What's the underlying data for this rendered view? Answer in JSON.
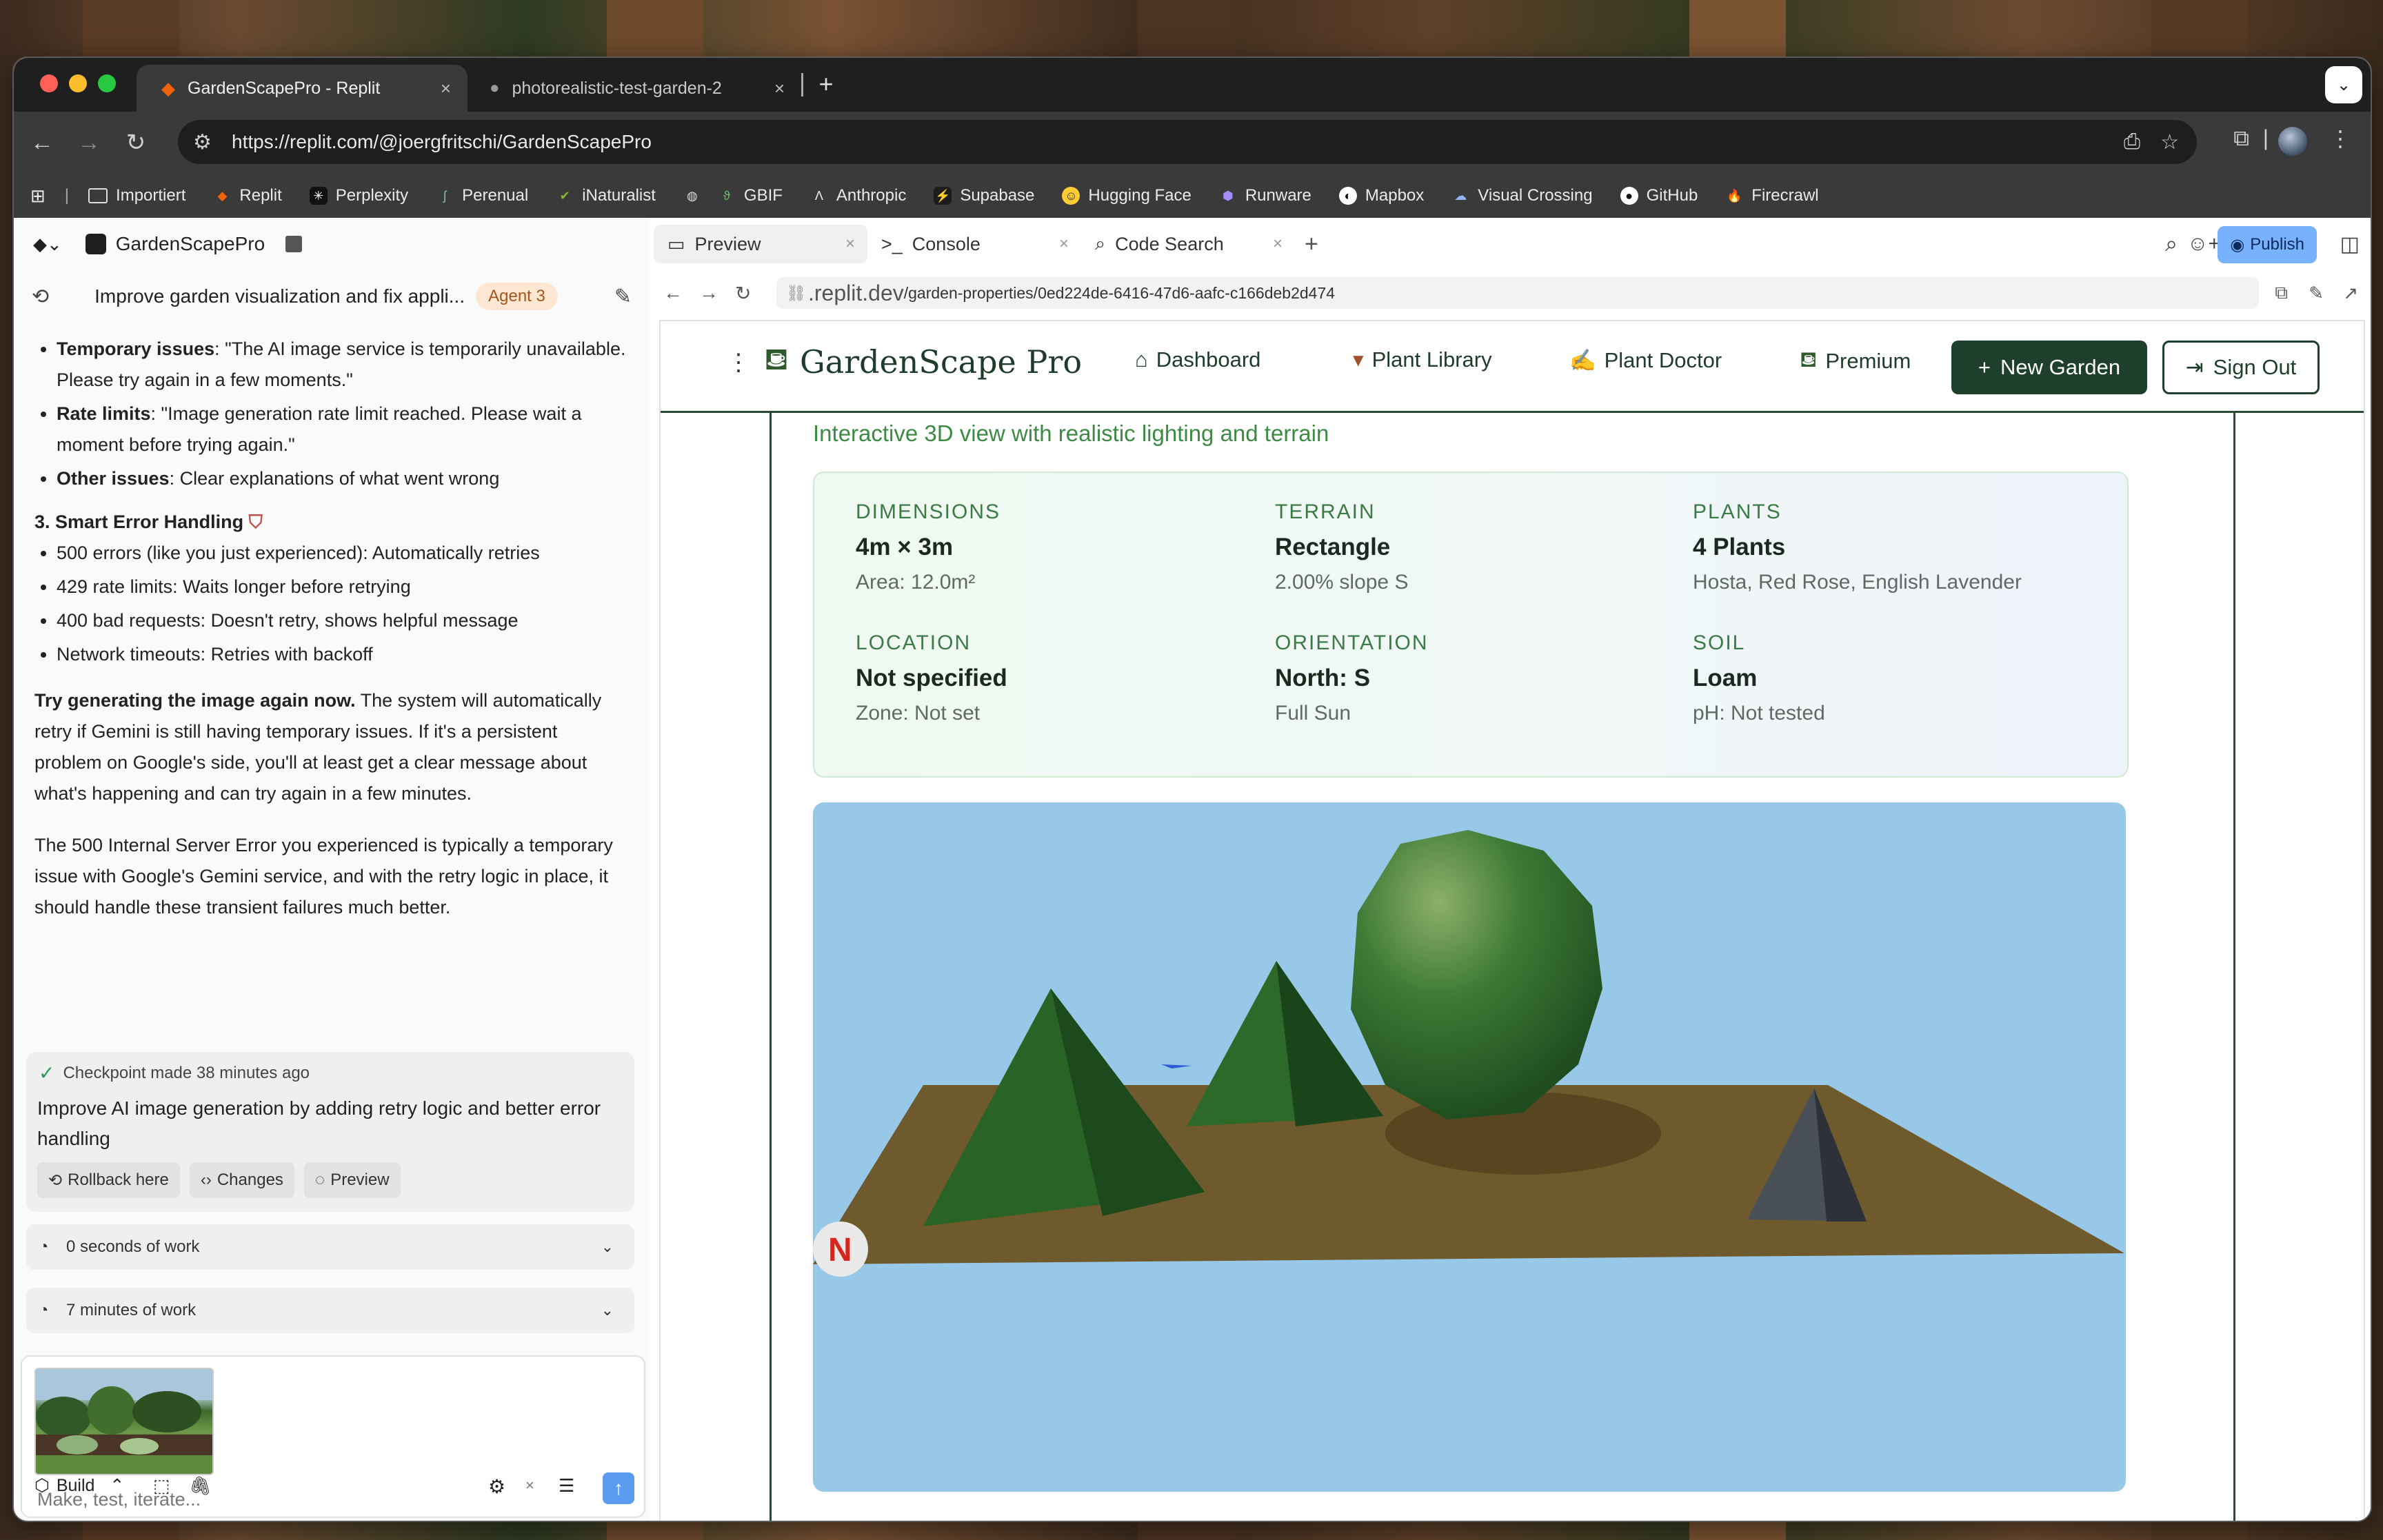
{
  "browser": {
    "tabs": [
      {
        "title": "GardenScapePro - Replit",
        "active": true
      },
      {
        "title": "photorealistic-test-garden-2",
        "active": false
      }
    ],
    "url": "https://replit.com/@joergfritschi/GardenScapePro",
    "bookmarks": [
      "Importiert",
      "Replit",
      "Perplexity",
      "Perenual",
      "iNaturalist",
      "GBIF",
      "Anthropic",
      "Supabase",
      "Hugging Face",
      "Runware",
      "Mapbox",
      "Visual Crossing",
      "GitHub",
      "Firecrawl"
    ]
  },
  "workspace": {
    "project_name": "GardenScapePro",
    "agent_title": "Improve garden visualization and fix appli...",
    "agent_badge": "Agent 3"
  },
  "chat": {
    "list1": [
      {
        "bold": "Temporary issues",
        "text": ": \"The AI image service is temporarily unavailable. Please try again in a few moments.\""
      },
      {
        "bold": "Rate limits",
        "text": ": \"Image generation rate limit reached. Please wait a moment before trying again.\""
      },
      {
        "bold": "Other issues",
        "text": ": Clear explanations of what went wrong"
      }
    ],
    "section_heading": "3. Smart Error Handling",
    "list2": [
      "500 errors (like you just experienced): Automatically retries",
      "429 rate limits: Waits longer before retrying",
      "400 bad requests: Doesn't retry, shows helpful message",
      "Network timeouts: Retries with backoff"
    ],
    "para1_bold": "Try generating the image again now.",
    "para1_text": " The system will automatically retry if Gemini is still having temporary issues. If it's a persistent problem on Google's side, you'll at least get a clear message about what's happening and can try again in a few minutes.",
    "para2": "The 500 Internal Server Error you experienced is typically a temporary issue with Google's Gemini service, and with the retry logic in place, it should handle these transient failures much better."
  },
  "checkpoint": {
    "status": "Checkpoint made 38 minutes ago",
    "message": "Improve AI image generation by adding retry logic and better error handling",
    "actions": [
      "Rollback here",
      "Changes",
      "Preview"
    ]
  },
  "work_items": [
    "0 seconds of work",
    "7 minutes of work"
  ],
  "composer": {
    "placeholder": "Make, test, iterate...",
    "mode": "Build"
  },
  "ws_tabs": [
    "Preview",
    "Console",
    "Code Search"
  ],
  "publish_label": "Publish",
  "preview_url": {
    "host": ".replit.dev",
    "path": "/garden-properties/0ed224de-6416-47d6-aafc-c166deb2d474"
  },
  "app": {
    "brand": "GardenScape Pro",
    "nav": [
      "Dashboard",
      "Plant Library",
      "Plant Doctor",
      "Premium"
    ],
    "new_garden": "New Garden",
    "sign_out": "Sign Out",
    "subtitle": "Interactive 3D view with realistic lighting and terrain",
    "info": [
      {
        "label": "DIMENSIONS",
        "value": "4m × 3m",
        "sub": "Area: 12.0m²"
      },
      {
        "label": "TERRAIN",
        "value": "Rectangle",
        "sub": "2.00% slope S"
      },
      {
        "label": "PLANTS",
        "value": "4 Plants",
        "sub": "Hosta, Red Rose, English Lavender"
      },
      {
        "label": "LOCATION",
        "value": "Not specified",
        "sub": "Zone: Not set"
      },
      {
        "label": "ORIENTATION",
        "value": "North: S",
        "sub": "Full Sun"
      },
      {
        "label": "SOIL",
        "value": "Loam",
        "sub": "pH: Not tested"
      }
    ],
    "compass": "N"
  },
  "colors": {
    "brand_green": "#1e3f2c",
    "accent_green": "#3c8a44",
    "sky": "#97c8e7",
    "ground": "#6e5a2c",
    "publish_blue": "#78b2ff"
  }
}
